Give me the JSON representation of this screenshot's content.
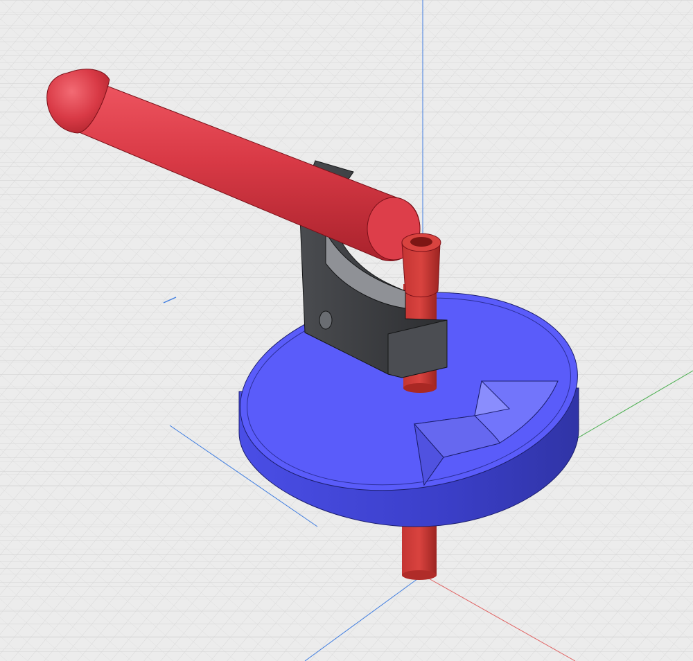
{
  "viewport": {
    "background": "#ececec",
    "grid_color": "#d3d3d3",
    "grid_line_color": "#c6c6c6"
  },
  "axes": {
    "x_axis_color": "#e06060",
    "y_axis_color": "#4caf50",
    "z_axis_color": "#3f7de0"
  },
  "model": {
    "parts": [
      {
        "name": "handle",
        "material_color": "#d93a46"
      },
      {
        "name": "bracket",
        "material_color": "#3b3d40"
      },
      {
        "name": "base-disc",
        "material_color": "#5a5cfa"
      },
      {
        "name": "spindle",
        "material_color": "#c8302c"
      }
    ]
  }
}
